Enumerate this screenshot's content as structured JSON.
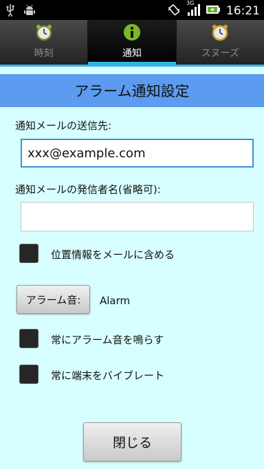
{
  "status_bar": {
    "time": "16:21",
    "network_type": "3G",
    "icons": [
      "usb-icon",
      "android-icon",
      "vibrate-icon",
      "signal-icon",
      "battery-icon"
    ]
  },
  "tabs": [
    {
      "label": "時刻",
      "icon": "alarm-clock-icon",
      "active": false
    },
    {
      "label": "通知",
      "icon": "info-icon",
      "active": true
    },
    {
      "label": "スヌーズ",
      "icon": "snooze-clock-icon",
      "active": false
    }
  ],
  "dialog": {
    "title": "アラーム通知設定",
    "email_label": "通知メールの送信先:",
    "email_value": "xxx@example.com",
    "sender_label": "通知メールの発信者名(省略可):",
    "sender_value": "",
    "include_location_label": "位置情報をメールに含める",
    "include_location_checked": false,
    "alarm_sound_button": "アラーム音:",
    "alarm_sound_value": "Alarm",
    "always_sound_label": "常にアラーム音を鳴らす",
    "always_sound_checked": false,
    "always_vibrate_label": "常に端末をバイブレート",
    "always_vibrate_checked": false,
    "close_button": "閉じる"
  },
  "colors": {
    "background": "#d8ffff",
    "header": "#5b9bf0",
    "tab_indicator": "#33b5e5",
    "input_focus": "#3a8fd8"
  }
}
